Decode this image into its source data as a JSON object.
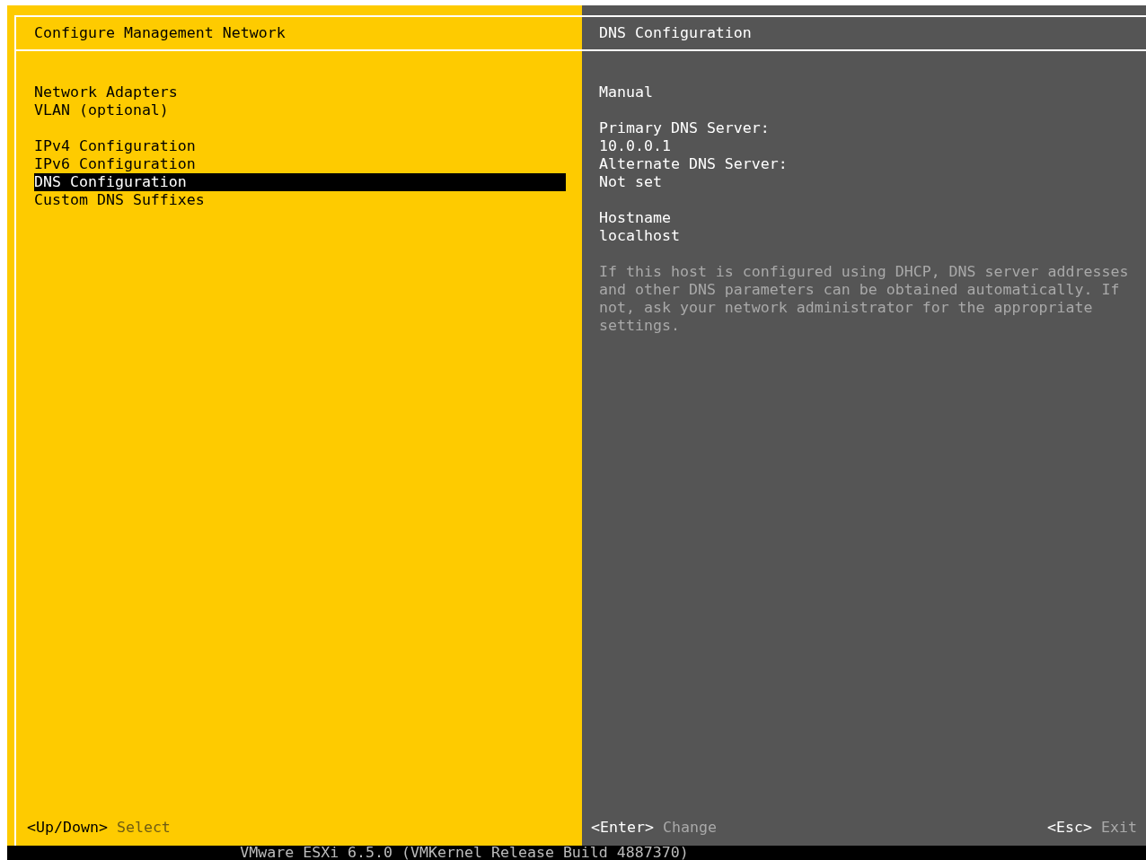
{
  "left_panel": {
    "title": "Configure Management Network",
    "menu_groups": [
      [
        {
          "label": "Network Adapters",
          "selected": false
        },
        {
          "label": "VLAN (optional)",
          "selected": false
        }
      ],
      [
        {
          "label": "IPv4 Configuration",
          "selected": false
        },
        {
          "label": "IPv6 Configuration",
          "selected": false
        },
        {
          "label": "DNS Configuration",
          "selected": true
        },
        {
          "label": "Custom DNS Suffixes",
          "selected": false
        }
      ]
    ],
    "footer_hints": [
      {
        "key": "<Up/Down>",
        "action": "Select"
      }
    ]
  },
  "right_panel": {
    "title": "DNS Configuration",
    "sections": [
      [
        "Manual"
      ],
      [
        "Primary DNS Server:",
        "10.0.0.1",
        "Alternate DNS Server:",
        "Not set"
      ],
      [
        "Hostname",
        "localhost"
      ]
    ],
    "help_text": "If this host is configured using DHCP, DNS server addresses and other DNS parameters can be obtained automatically. If not, ask your network administrator for the appropriate settings.",
    "footer_hints": [
      {
        "key": "<Enter>",
        "action": "Change"
      },
      {
        "key": "<Esc>",
        "action": "Exit"
      }
    ]
  },
  "status_bar": "VMware ESXi 6.5.0 (VMKernel Release Build 4887370)"
}
